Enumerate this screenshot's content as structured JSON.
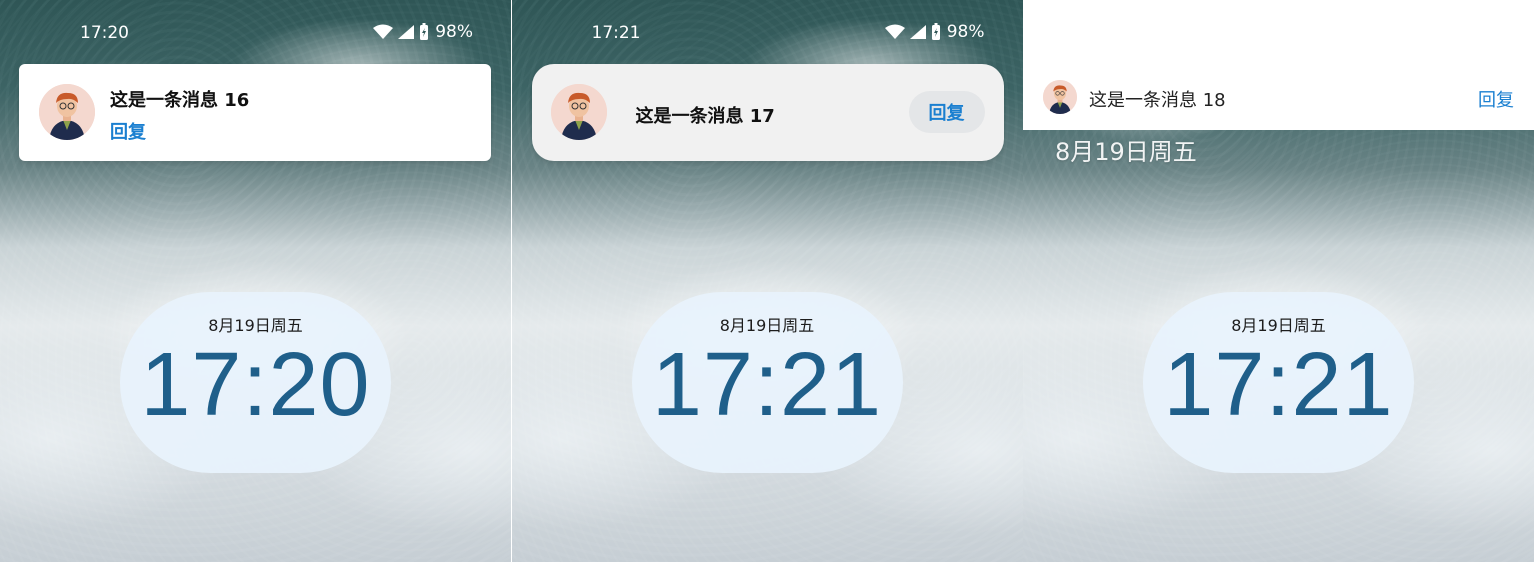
{
  "panels": [
    {
      "status_time": "17:20",
      "battery_pct": "98%",
      "notification": {
        "title": "这是一条消息 16",
        "reply": "回复"
      },
      "clock": {
        "date": "8月19日周五",
        "time": "17:20"
      }
    },
    {
      "status_time": "17:21",
      "battery_pct": "98%",
      "notification": {
        "title": "这是一条消息 17",
        "reply": "回复"
      },
      "clock": {
        "date": "8月19日周五",
        "time": "17:21"
      }
    },
    {
      "notification": {
        "title": "这是一条消息 18",
        "reply": "回复"
      },
      "floating_date": "8月19日周五",
      "clock": {
        "date": "8月19日周五",
        "time": "17:21"
      }
    }
  ],
  "icons": {
    "wifi": "wifi-icon",
    "signal": "signal-icon",
    "battery": "battery-charging-icon",
    "avatar": "avatar-illustration"
  },
  "colors": {
    "accent_blue": "#1a7fd0",
    "clock_text": "#1f5f8a",
    "clock_bg": "#e8f2fc"
  }
}
